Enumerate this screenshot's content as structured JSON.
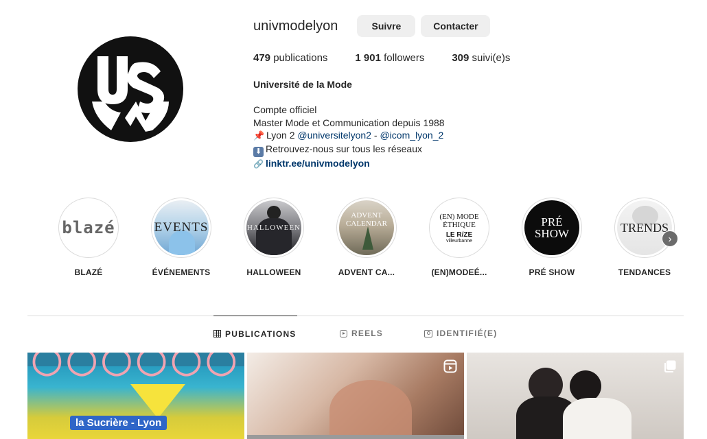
{
  "profile": {
    "username": "univmodelyon",
    "follow_label": "Suivre",
    "contact_label": "Contacter",
    "stats": {
      "posts_count": "479",
      "posts_label": "publications",
      "followers_count": "1 901",
      "followers_label": "followers",
      "following_count": "309",
      "following_label": "suivi(e)s"
    },
    "full_name": "Université de la Mode",
    "bio": {
      "line1": "Compte officiel",
      "line2": "Master Mode et Communication depuis 1988",
      "line3_prefix": "Lyon 2 ",
      "line3_mention1": "@universitelyon2",
      "line3_sep": " - ",
      "line3_mention2": "@icom_lyon_2",
      "line4": "Retrouvez-nous sur tous les réseaux",
      "link": "linktr.ee/univmodelyon"
    },
    "logo_text": "USM"
  },
  "highlights": [
    {
      "label": "BLAZÉ",
      "cover_text": "blazé"
    },
    {
      "label": "ÉVÉNEMENTS",
      "cover_text": "EVENTS"
    },
    {
      "label": "HALLOWEEN",
      "cover_text": "HALLOWEEN"
    },
    {
      "label": "ADVENT CA...",
      "cover_text": "ADVENT CALENDAR"
    },
    {
      "label": "(EN)MODEÉ...",
      "cover_text_1": "(EN) MODE",
      "cover_text_2": "ÉTHIQUE",
      "cover_text_3": "LE R/ZE",
      "cover_text_4": "villeurbanne"
    },
    {
      "label": "PRÉ SHOW",
      "cover_text_1": "PRÉ",
      "cover_text_2": "SHOW"
    },
    {
      "label": "TENDANCES",
      "cover_text": "TRENDS"
    }
  ],
  "tabs": [
    {
      "label": "PUBLICATIONS",
      "icon": "grid-icon",
      "active": true
    },
    {
      "label": "REELS",
      "icon": "reels-icon",
      "active": false
    },
    {
      "label": "IDENTIFIÉ(E)",
      "icon": "tagged-icon",
      "active": false
    }
  ],
  "posts": [
    {
      "overlay_text": "la Sucrière - Lyon",
      "type_icon": "none"
    },
    {
      "type_icon": "reel-icon"
    },
    {
      "type_icon": "carousel-icon"
    }
  ],
  "colors": {
    "text_primary": "#262626",
    "text_secondary": "#737373",
    "link": "#00376b",
    "button_bg": "#efefef",
    "border": "#dbdbdb"
  }
}
